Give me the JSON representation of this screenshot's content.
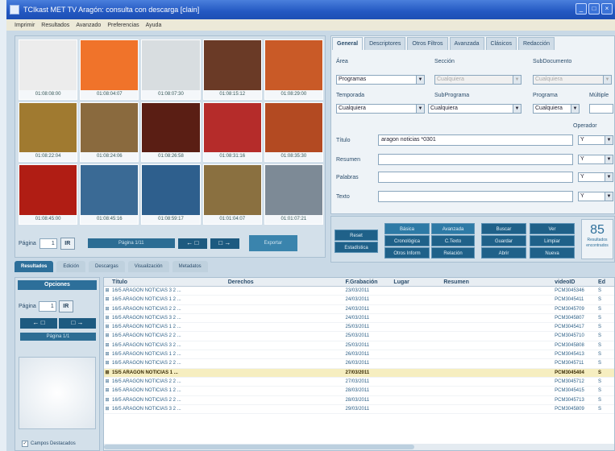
{
  "window": {
    "title": "TCIkast MET TV Aragón: consulta con descarga [clain]"
  },
  "menu": [
    "Imprimir",
    "Resultados",
    "Avanzado",
    "Preferencias",
    "Ayuda"
  ],
  "thumbnails": [
    {
      "tc": "01:08:08:00",
      "color": "#ececec"
    },
    {
      "tc": "01:08:04:07",
      "color": "#f0732a"
    },
    {
      "tc": "01:08:07:30",
      "color": "#d8dde0"
    },
    {
      "tc": "01:08:15:12",
      "color": "#6a3a26"
    },
    {
      "tc": "01:08:29:00",
      "color": "#c95a27"
    },
    {
      "tc": "01:08:22:04",
      "color": "#a07a30"
    },
    {
      "tc": "01:08:24:06",
      "color": "#8a6a3e"
    },
    {
      "tc": "01:08:26:58",
      "color": "#5a1e14"
    },
    {
      "tc": "01:08:31:16",
      "color": "#b52c2a"
    },
    {
      "tc": "01:08:35:30",
      "color": "#b34a22"
    },
    {
      "tc": "01:08:45:00",
      "color": "#b01d14"
    },
    {
      "tc": "01:08:45:16",
      "color": "#3a6a95"
    },
    {
      "tc": "01:08:59:17",
      "color": "#2e5f8d"
    },
    {
      "tc": "01:01:04:07",
      "color": "#8a7040"
    },
    {
      "tc": "01:01:07:21",
      "color": "#7d8a96"
    }
  ],
  "pager": {
    "label": "Página",
    "value": "1",
    "go": "IR",
    "info": "Página 1/11",
    "prev": "← □",
    "next": "□ →",
    "export": "Exportar"
  },
  "tabs": [
    "General",
    "Descriptores",
    "Otros Filtros",
    "Avanzada",
    "Clásicos",
    "Redacción"
  ],
  "form": {
    "area_label": "Área",
    "area_value": "Programas",
    "seccion_label": "Sección",
    "seccion_value": "Cualquiera",
    "subdoc_label": "SubDocumento",
    "subdoc_value": "Cualquiera",
    "temporada_label": "Temporada",
    "temporada_value": "Cualquiera",
    "subprograma_label": "SubPrograma",
    "subprograma_value": "Cualquiera",
    "programa_label": "Programa",
    "programa_value": "Cualquiera",
    "multiple_label": "Múltiple",
    "operador_label": "Operador",
    "titulo_label": "Título",
    "titulo_value": "aragon noticias *0301",
    "resumen_label": "Resumen",
    "palabras_label": "Palabras",
    "texto_label": "Texto",
    "op1": "Y",
    "op2": "Y",
    "op3": "Y",
    "op4": "Y"
  },
  "actions": {
    "reset": "Reset",
    "estadist": "Estadística",
    "basica": "Básica",
    "avanzada": "Avanzada",
    "buscar": "Buscar",
    "ver": "Ver",
    "cronologica": "Cronológica",
    "ctexto": "C.Texto",
    "guardar": "Guardar",
    "limpiar": "Limpiar",
    "otros": "Otros Inform",
    "relacion": "Relación",
    "abrir": "Abrir",
    "nueva": "Nueva"
  },
  "counter": {
    "value": "85",
    "caption": "Resultados encontrados"
  },
  "bottom_tabs": [
    "Resultados",
    "Edición",
    "Descargas",
    "Visualización",
    "Metadatos"
  ],
  "options": {
    "title": "Opciones",
    "page_label": "Página",
    "page_value": "1",
    "go": "IR",
    "info": "Página 1/1",
    "checkbox": "Campos Destacados"
  },
  "table": {
    "headers": [
      "Título",
      "Derechos",
      "F.Grabación",
      "Lugar",
      "Resumen",
      "videoID",
      "Ed"
    ],
    "rows": [
      {
        "t": "16/5 ARAGON NOTICIAS 3 2 ...",
        "d": "23/03/2011",
        "v": "PCM3045346",
        "e": "S"
      },
      {
        "t": "16/5 ARAGON NOTICIAS 1 2 ...",
        "d": "24/03/2011",
        "v": "PCM3045411",
        "e": "S"
      },
      {
        "t": "16/5 ARAGON NOTICIAS 2 2 ...",
        "d": "24/03/2011",
        "v": "PCM3045709",
        "e": "S"
      },
      {
        "t": "16/5 ARAGON NOTICIAS 3 2 ...",
        "d": "24/03/2011",
        "v": "PCM3045807",
        "e": "S"
      },
      {
        "t": "16/5 ARAGON NOTICIAS 1 2 ...",
        "d": "25/03/2011",
        "v": "PCM3045417",
        "e": "S"
      },
      {
        "t": "16/5 ARAGON NOTICIAS 2 2 ...",
        "d": "25/03/2011",
        "v": "PCM3045710",
        "e": "S"
      },
      {
        "t": "16/5 ARAGON NOTICIAS 3 2 ...",
        "d": "25/03/2011",
        "v": "PCM3045808",
        "e": "S"
      },
      {
        "t": "16/5 ARAGON NOTICIAS 1 2 ...",
        "d": "26/03/2011",
        "v": "PCM3045413",
        "e": "S"
      },
      {
        "t": "16/5 ARAGON NOTICIAS 2 2 ...",
        "d": "26/03/2011",
        "v": "PCM3045711",
        "e": "S"
      },
      {
        "t": "15/5 ARAGON NOTICIAS 1 ...",
        "d": "27/03/2011",
        "v": "PCM3045404",
        "e": "S",
        "hl": true
      },
      {
        "t": "16/5 ARAGON NOTICIAS 2 2 ...",
        "d": "27/03/2011",
        "v": "PCM3045712",
        "e": "S"
      },
      {
        "t": "16/5 ARAGON NOTICIAS 1 2 ...",
        "d": "28/03/2011",
        "v": "PCM3045415",
        "e": "S"
      },
      {
        "t": "16/5 ARAGON NOTICIAS 2 2 ...",
        "d": "28/03/2011",
        "v": "PCM3045713",
        "e": "S"
      },
      {
        "t": "16/5 ARAGON NOTICIAS 3 2 ...",
        "d": "29/03/2011",
        "v": "PCM3045809",
        "e": "S"
      }
    ]
  },
  "colors": {
    "accent": "#2d6f9a",
    "highlight": "#f6eec0",
    "title_bar": "#2358c2"
  }
}
